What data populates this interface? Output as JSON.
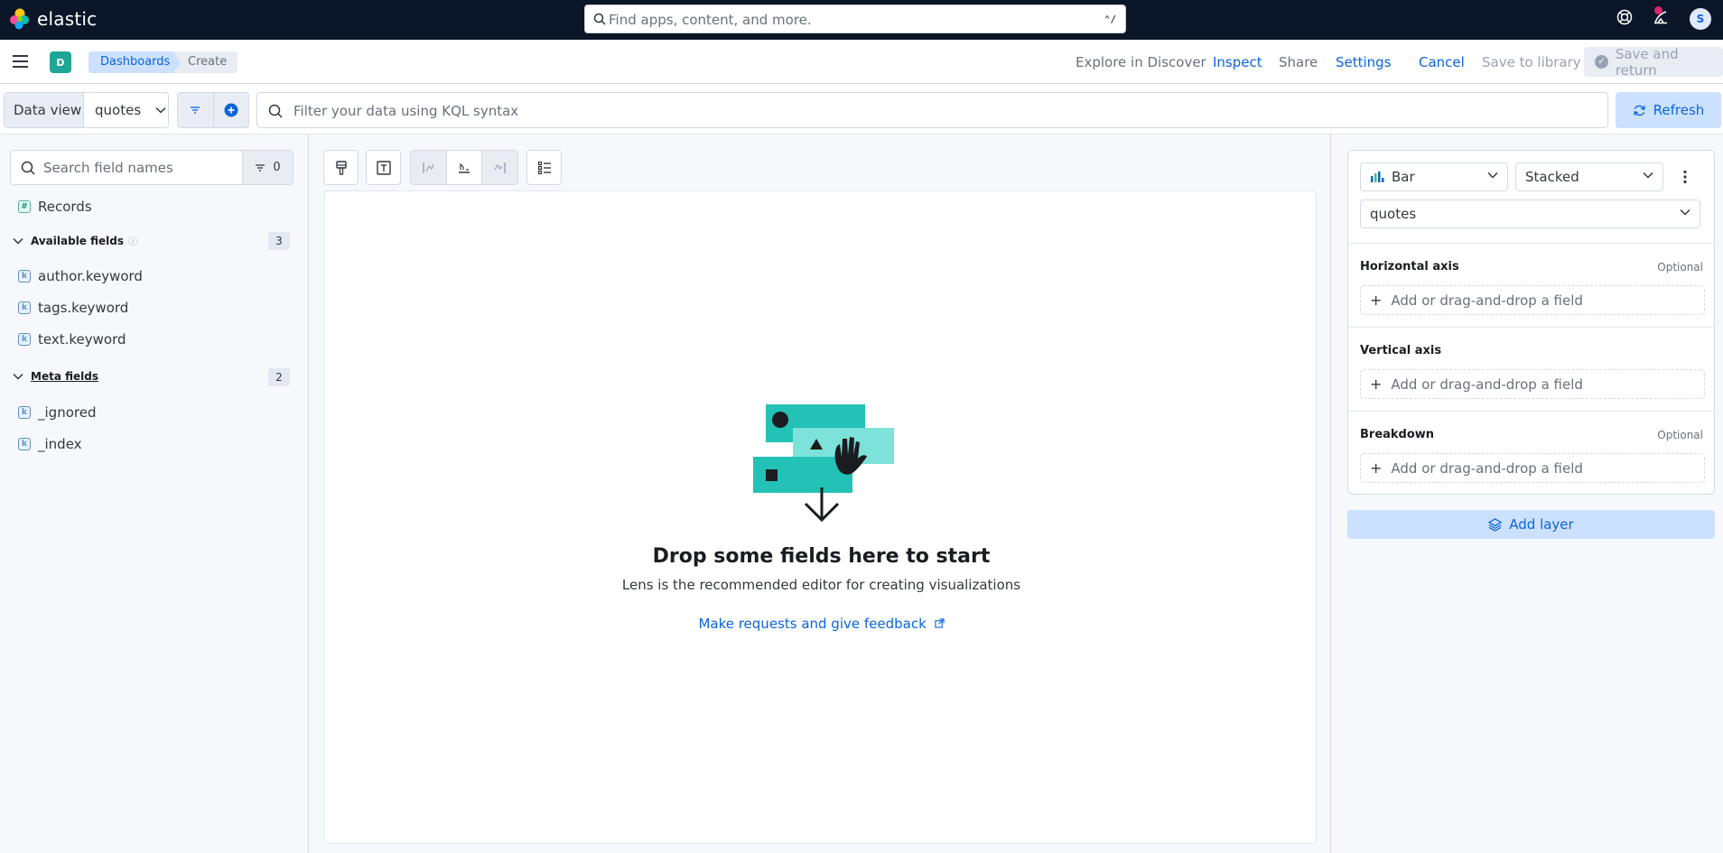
{
  "header": {
    "brand": "elastic",
    "search_placeholder": "Find apps, content, and more.",
    "search_shortcut": "⌃/",
    "user_initial": "S"
  },
  "appbar": {
    "space_initial": "D",
    "breadcrumbs": [
      "Dashboards",
      "Create"
    ],
    "links": {
      "explore": "Explore in Discover",
      "inspect": "Inspect",
      "share": "Share",
      "settings": "Settings",
      "cancel": "Cancel",
      "save_library": "Save to library",
      "save_return": "Save and return"
    }
  },
  "query": {
    "data_view_label": "Data view",
    "data_view_value": "quotes",
    "kql_placeholder": "Filter your data using KQL syntax",
    "refresh_label": "Refresh"
  },
  "fields": {
    "search_placeholder": "Search field names",
    "filter_count": "0",
    "records_label": "Records",
    "available": {
      "title": "Available fields",
      "count": "3",
      "items": [
        "author.keyword",
        "tags.keyword",
        "text.keyword"
      ]
    },
    "meta": {
      "title": "Meta fields",
      "count": "2",
      "items": [
        "_ignored",
        "_index"
      ]
    },
    "token_keyword": "k",
    "token_number": "#"
  },
  "canvas": {
    "title": "Drop some fields here to start",
    "subtitle": "Lens is the recommended editor for creating visualizations",
    "feedback_link": "Make requests and give feedback"
  },
  "config": {
    "chart_type": "Bar",
    "stacking": "Stacked",
    "data_view": "quotes",
    "horizontal_axis": "Horizontal axis",
    "vertical_axis": "Vertical axis",
    "breakdown": "Breakdown",
    "optional": "Optional",
    "drop_placeholder": "Add or drag-and-drop a field",
    "add_layer": "Add layer"
  },
  "colors": {
    "header_bg": "#0b1628",
    "primary": "#0b64dd",
    "accent_teal": "#1ea593",
    "illustration_teal": "#24c2b6",
    "notification": "#d6286a"
  }
}
